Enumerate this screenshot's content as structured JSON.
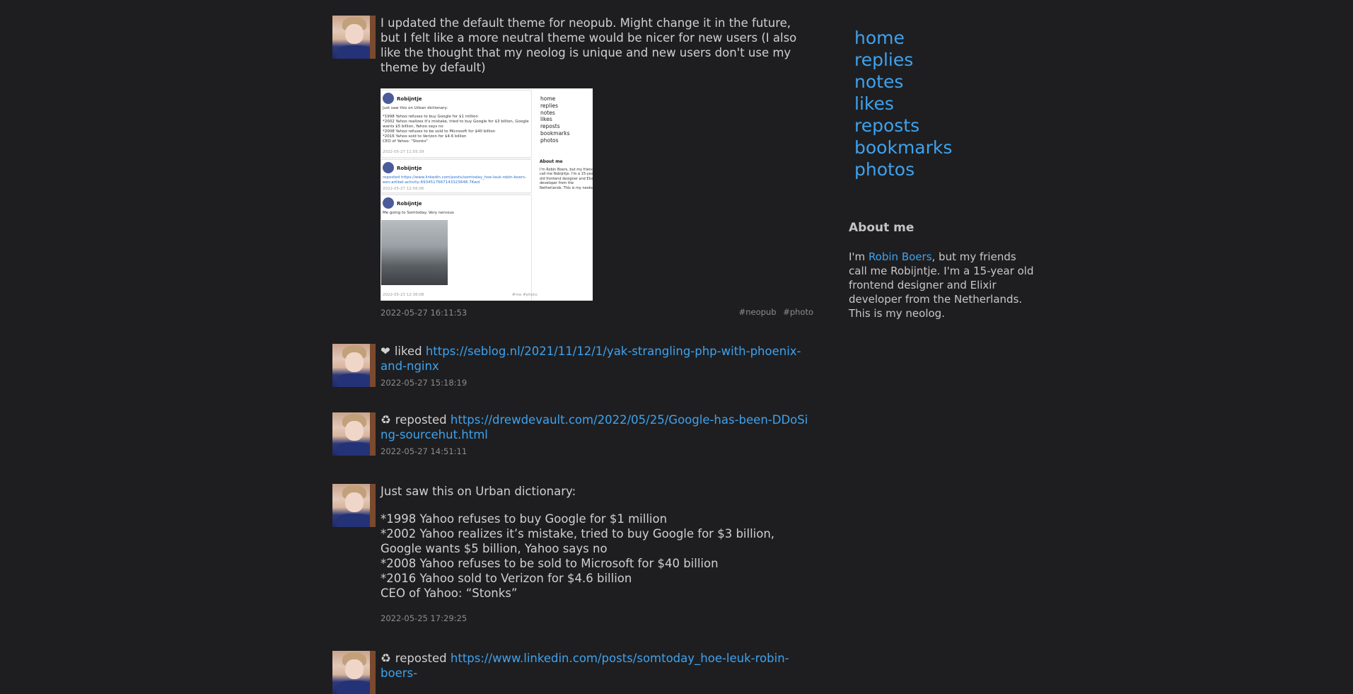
{
  "posts": [
    {
      "text": "I updated the default theme for neopub. Might change it in the future, but I felt like a more neutral theme would be nicer for new users (I also like the thought that my neolog is unique and new users don't use my theme by default)",
      "timestamp": "2022-05-27 16:11:53",
      "tags": [
        "#neopub",
        "#photo"
      ],
      "image": {
        "author": "Robijntje",
        "card1_lines": [
          "Just saw this on Urban dictionary:",
          "*1998 Yahoo refuses to buy Google for $1 million",
          "*2002 Yahoo realizes it's mistake, tried to buy Google for $3 billion, Google",
          "wants $5 billion, Yahoo says no",
          "*2008 Yahoo refuses to be sold to Microsoft for $40 billion",
          "*2016 Yahoo sold to Verizon for $4.6 billion",
          "CEO of Yahoo: \"Stonks\""
        ],
        "card1_time": "2022-05-27 11:55:39",
        "card2_lines": [
          "reposted https://www.linkedin.com/posts/somtoday_hoe-leuk-robin-boers-",
          "een-artikel-activity-6934517667143323648-7Kwd"
        ],
        "card2_time": "2022-05-27 12:56:06",
        "card3_line": "Me going to Somtoday. Very nervous",
        "card3_time": "2022-05-23 12:36:08",
        "card3_tags": "#me #photo",
        "nav": [
          "home",
          "replies",
          "notes",
          "likes",
          "reposts",
          "bookmarks",
          "photos"
        ],
        "about_title": "About me",
        "about_text": "I'm Robin Boers, but my friends call me Robijntje. I'm a 15-year old frontend designer and Elixir developer from the Netherlands. This is my neolog."
      }
    },
    {
      "action": "liked",
      "icon": "heart-icon",
      "link": "https://seblog.nl/2021/11/12/1/yak-strangling-php-with-phoenix-and-nginx",
      "timestamp": "2022-05-27 15:18:19"
    },
    {
      "action": "reposted",
      "icon": "repost-icon",
      "link": "https://drewdevault.com/2022/05/25/Google-has-been-DDoSing-sourcehut.html",
      "timestamp": "2022-05-27 14:51:11"
    },
    {
      "intro": "Just saw this on Urban dictionary:",
      "lines": "*1998 Yahoo refuses to buy Google for $1 million\n*2002 Yahoo realizes it’s mistake, tried to buy Google for $3 billion, Google wants $5 billion, Yahoo says no\n*2008 Yahoo refuses to be sold to Microsoft for $40 billion\n*2016 Yahoo sold to Verizon for $4.6 billion\nCEO of Yahoo: “Stonks”",
      "timestamp": "2022-05-25 17:29:25"
    },
    {
      "action": "reposted",
      "icon": "repost-icon",
      "link": "https://www.linkedin.com/posts/somtoday_hoe-leuk-robin-boers-"
    }
  ],
  "sidebar": {
    "nav": [
      "home",
      "replies",
      "notes",
      "likes",
      "reposts",
      "bookmarks",
      "photos"
    ],
    "about_title": "About me",
    "about_prefix": "I'm ",
    "about_name": "Robin Boers",
    "about_suffix": ", but my friends call me Robijntje. I'm a 15-year old frontend designer and Elixir developer from the Netherlands. This is my neolog."
  },
  "colors": {
    "background": "#1e1e20",
    "link": "#3fa2ee",
    "text": "#d0d0d0",
    "muted": "#8c8c8c"
  }
}
